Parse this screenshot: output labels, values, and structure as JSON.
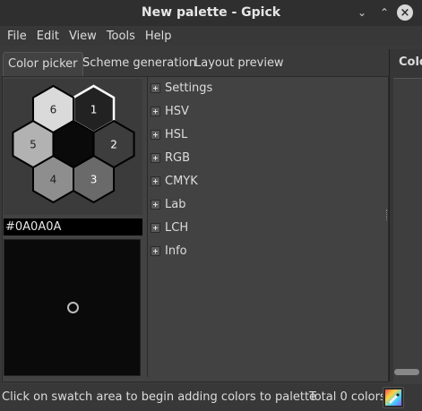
{
  "window": {
    "title": "New palette - Gpick",
    "controls": [
      "minimize",
      "maximize",
      "close"
    ]
  },
  "menu": [
    "File",
    "Edit",
    "View",
    "Tools",
    "Help"
  ],
  "tabs": [
    {
      "label": "Color picker",
      "active": true
    },
    {
      "label": "Scheme generation",
      "active": false
    },
    {
      "label": "Layout preview",
      "active": false
    }
  ],
  "right_pane": {
    "title": "Colo"
  },
  "swatches": [
    {
      "label": "1",
      "color": "#222222"
    },
    {
      "label": "2",
      "color": "#3d3d3d"
    },
    {
      "label": "3",
      "color": "#6a6a6a"
    },
    {
      "label": "4",
      "color": "#8e8e8e"
    },
    {
      "label": "5",
      "color": "#b2b2b2"
    },
    {
      "label": "6",
      "color": "#dadada"
    },
    {
      "label": "",
      "color": "#0a0a0a"
    }
  ],
  "color_value": "#0A0A0A",
  "sections": [
    "Settings",
    "HSV",
    "HSL",
    "RGB",
    "CMYK",
    "Lab",
    "LCH",
    "Info"
  ],
  "status": {
    "message": "Click on swatch area to begin adding colors to palette",
    "total": "Total 0 colors"
  },
  "colors": {
    "background": "#3a3a3a",
    "titlebar": "#2f2f2f",
    "panel": "#424242",
    "swatch_area": "#0a0a0a"
  }
}
